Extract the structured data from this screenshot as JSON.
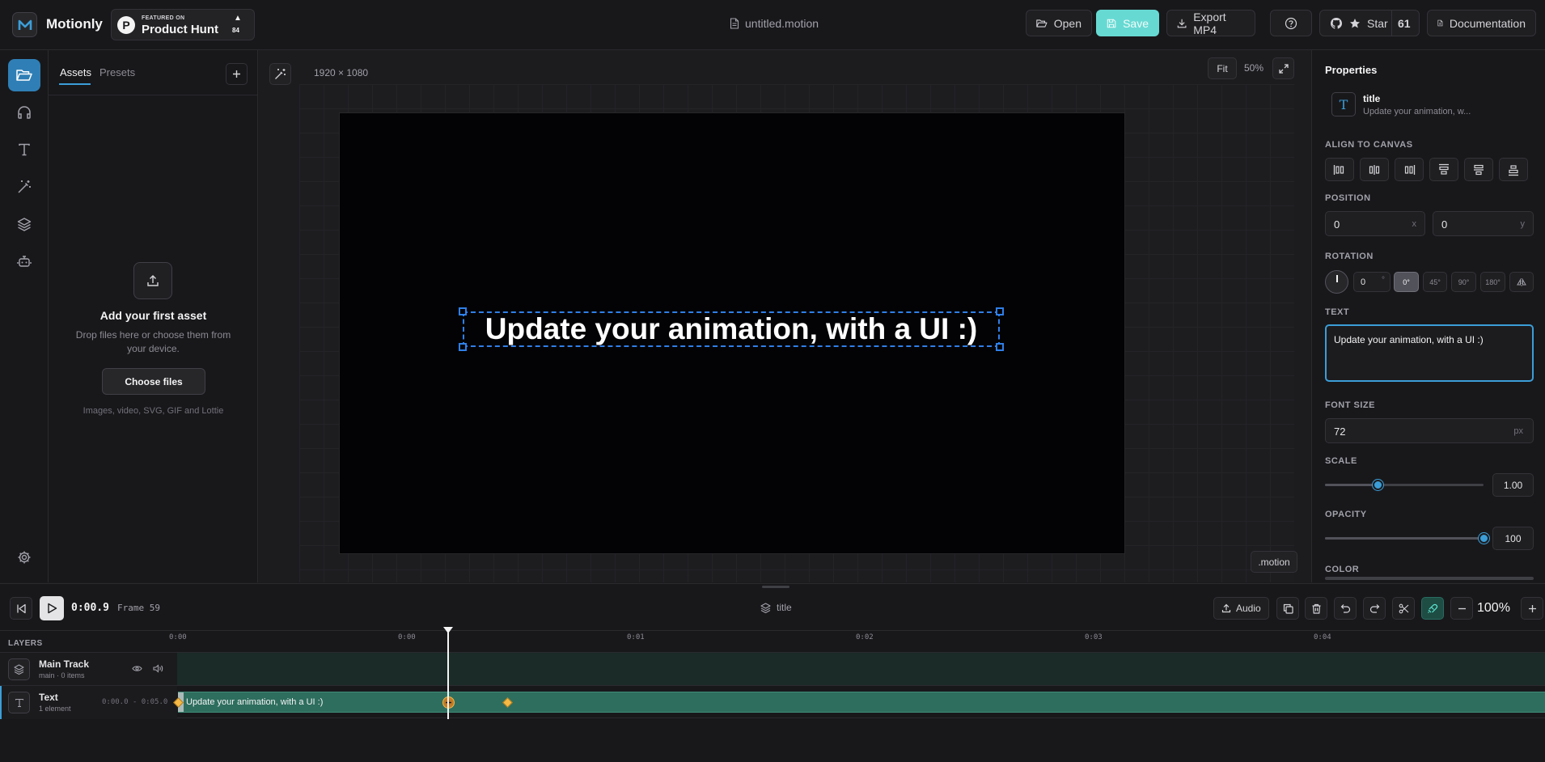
{
  "app": {
    "name": "Motionly",
    "product_hunt": {
      "featured": "FEATURED ON",
      "label": "Product Hunt",
      "upvotes": "84"
    },
    "file_name": "untitled.motion"
  },
  "toolbar": {
    "open": "Open",
    "save": "Save",
    "export": "Export MP4",
    "star": "Star",
    "star_count": "61",
    "docs": "Documentation"
  },
  "assets": {
    "tabs": [
      "Assets",
      "Presets"
    ],
    "empty_title": "Add your first asset",
    "empty_desc": "Drop files here or choose them from your device.",
    "choose": "Choose files",
    "formats": "Images, video, SVG, GIF and Lottie"
  },
  "canvas": {
    "dimensions": "1920 × 1080",
    "fit": "Fit",
    "zoom": "50%",
    "text": "Update your animation, with a UI :)",
    "file_tag": ".motion"
  },
  "properties": {
    "title": "Properties",
    "element_name": "title",
    "element_preview": "Update your animation, w...",
    "align_label": "ALIGN TO CANVAS",
    "position_label": "POSITION",
    "position": {
      "x": "0",
      "x_unit": "x",
      "y": "0",
      "y_unit": "y"
    },
    "rotation_label": "ROTATION",
    "rotation_value": "0",
    "rotation_unit": "°",
    "rotation_presets": [
      "0°",
      "45°",
      "90°",
      "180°"
    ],
    "text_label": "TEXT",
    "text_value": "Update your animation, with a UI :)",
    "font_size_label": "FONT SIZE",
    "font_size": "72",
    "font_size_unit": "px",
    "scale_label": "SCALE",
    "scale": "1.00",
    "scale_fraction": 0.33,
    "opacity_label": "OPACITY",
    "opacity": "100",
    "opacity_fraction": 1.0,
    "color_label": "COLOR"
  },
  "timeline": {
    "time": "0:00.9",
    "frame": "Frame 59",
    "selected": "title",
    "audio": "Audio",
    "zoom": "100%",
    "layers_label": "LAYERS",
    "ruler": [
      "0:00",
      "0:00",
      "0:01",
      "0:02",
      "0:03",
      "0:04"
    ],
    "tracks": [
      {
        "name": "Main Track",
        "sub": "main · 0 items"
      },
      {
        "name": "Text",
        "sub": "1 element",
        "range": "0:00.0 - 0:05.0",
        "clip": "Update your animation, with a UI :)"
      }
    ]
  },
  "colors": {
    "accent": "#3b9ed8",
    "save": "#67d9d3",
    "clip": "#2e6e5e",
    "keyframe": "#f5b945"
  }
}
